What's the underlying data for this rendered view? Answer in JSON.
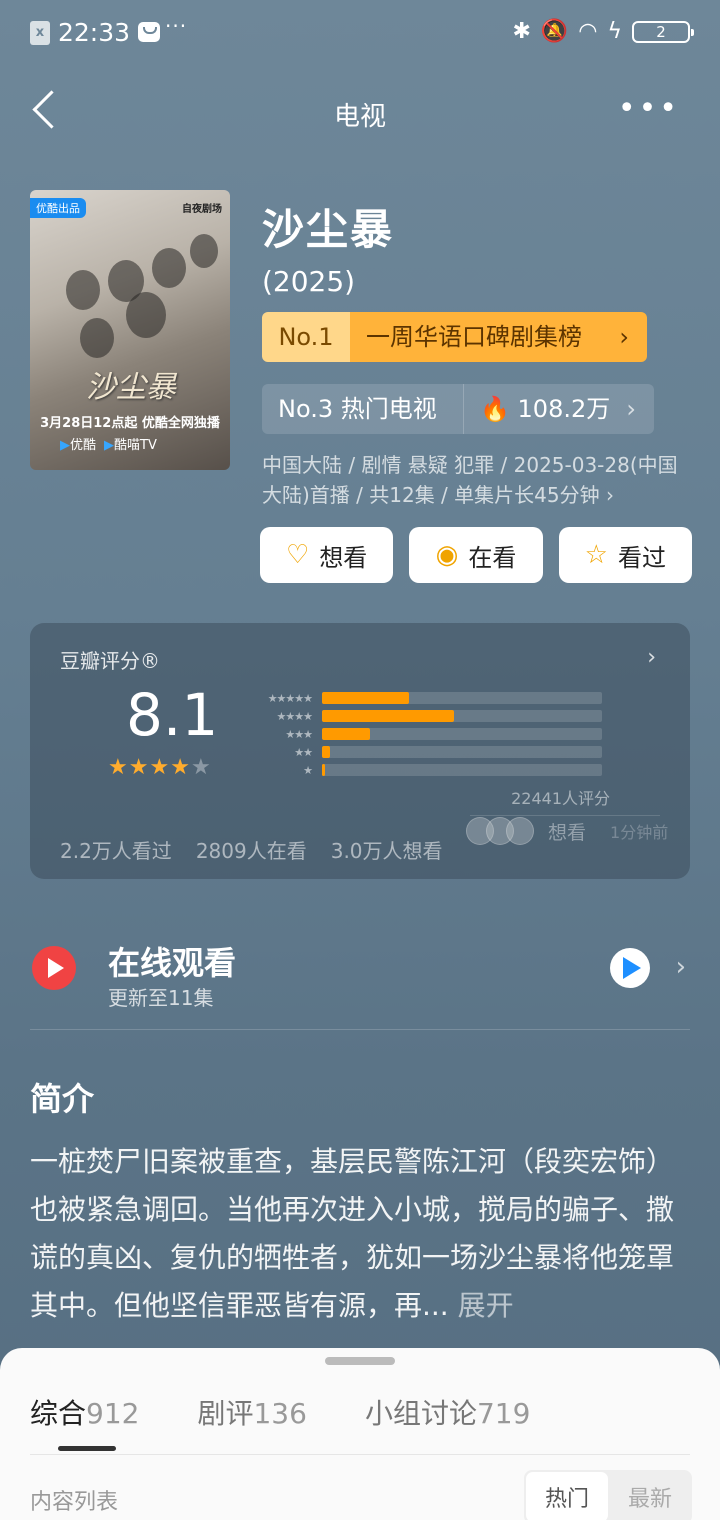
{
  "status_bar": {
    "time": "22:33",
    "sim_icon": "sim-x-icon",
    "mail_icon": "mail-icon",
    "more": "···",
    "bluetooth_icon": "bluetooth-icon",
    "mute_icon": "bell-off-icon",
    "wifi_icon": "wifi-icon",
    "charging_icon": "lightning-icon",
    "battery": "2"
  },
  "nav": {
    "title": "电视",
    "back_icon": "chevron-left-icon",
    "more_icon": "more-horizontal-icon"
  },
  "poster": {
    "tag": "优酷出品",
    "studio": "自夜剧场",
    "logo": "沙尘暴",
    "date_line": "3月28日12点起 优酷全网独播",
    "platform_1": "优酷",
    "platform_2": "酷喵TV"
  },
  "show": {
    "title": "沙尘暴",
    "year": "(2025)",
    "rank1_no": "No.1",
    "rank1_list": "一周华语口碑剧集榜",
    "rank2_text": "No.3 热门电视",
    "rank2_heat": "108.2万",
    "meta": "中国大陆 / 剧情 悬疑 犯罪 / 2025-03-28(中国大陆)首播 / 共12集 / 单集片长45分钟"
  },
  "actions": {
    "want": "想看",
    "watching": "在看",
    "watched": "看过"
  },
  "rating": {
    "header": "豆瓣评分®",
    "score": "8.1",
    "stars": 4,
    "distribution": [
      {
        "label": "★★★★★",
        "fraction": 0.31
      },
      {
        "label": "★★★★",
        "fraction": 0.47
      },
      {
        "label": "★★★",
        "fraction": 0.17
      },
      {
        "label": "★★",
        "fraction": 0.03
      },
      {
        "label": "★",
        "fraction": 0.01
      }
    ],
    "count": "22441人评分",
    "watched": "2.2万人看过",
    "watching": "2809人在看",
    "wanting": "3.0万人想看",
    "friend_action": "想看",
    "friend_time": "1分钟前"
  },
  "watch_online": {
    "label": "在线观看",
    "sub": "更新至11集",
    "play_icon": "play-icon",
    "platform_icon": "youku-logo-icon"
  },
  "intro": {
    "title": "简介",
    "text": "一桩焚尸旧案被重查，基层民警陈江河（段奕宏饰）也被紧急调回。当他再次进入小城，搅局的骗子、撒谎的真凶、复仇的牺牲者，犹如一场沙尘暴将他笼罩其中。但他坚信罪恶皆有源，再...",
    "expand": "展开"
  },
  "sheet": {
    "tabs": [
      {
        "label": "综合",
        "count": "912"
      },
      {
        "label": "剧评",
        "count": "136"
      },
      {
        "label": "小组讨论",
        "count": "719"
      }
    ],
    "list_label": "内容列表",
    "sort_hot": "热门",
    "sort_new": "最新"
  }
}
